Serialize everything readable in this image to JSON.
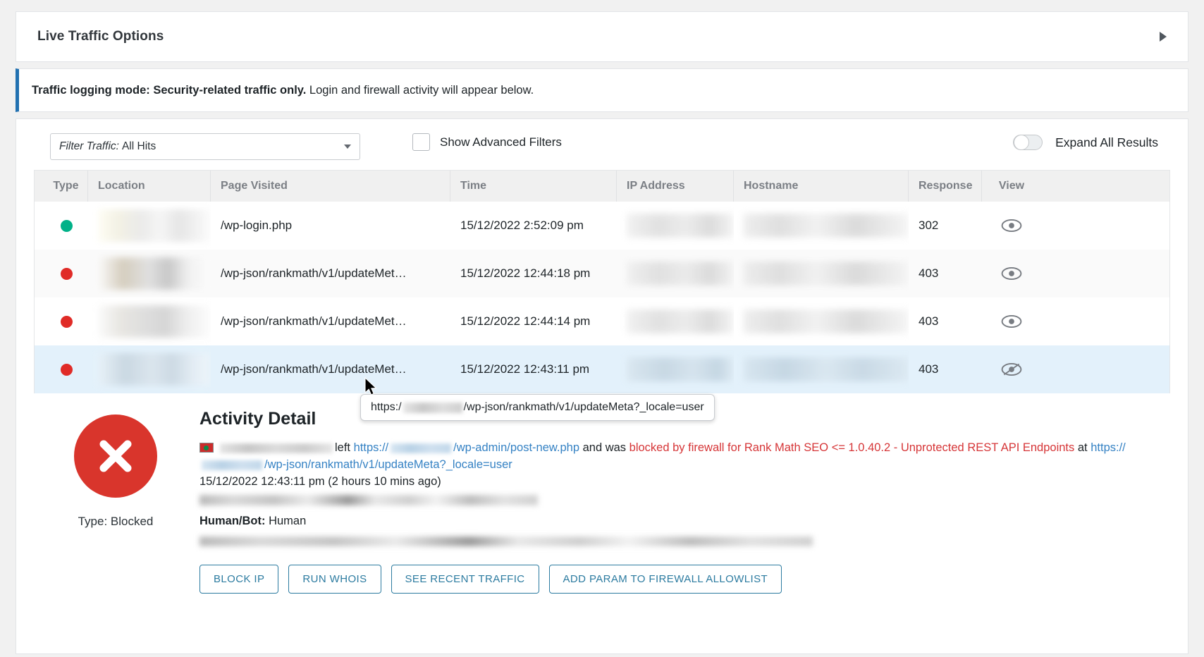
{
  "options_panel": {
    "title": "Live Traffic Options",
    "expand_icon": "chevron-right-icon"
  },
  "notice": {
    "bold_text": "Traffic logging mode: Security-related traffic only.",
    "rest_text": " Login and firewall activity will appear below."
  },
  "filters": {
    "select_label": "Filter Traffic:",
    "select_value": "All Hits",
    "advanced_filters_label": "Show Advanced Filters",
    "advanced_filters_checked": false,
    "expand_all_label": "Expand All Results",
    "expand_all_on": false
  },
  "table": {
    "columns": [
      "Type",
      "Location",
      "Page Visited",
      "Time",
      "IP Address",
      "Hostname",
      "Response",
      "View"
    ],
    "rows": [
      {
        "type_color": "#00b188",
        "type_name": "allowed",
        "location": "",
        "page": "/wp-login.php",
        "time": "15/12/2022 2:52:09 pm",
        "ip": "",
        "hostname": "",
        "response": "302",
        "view_icon": "eye-icon",
        "selected": false
      },
      {
        "type_color": "#e02b27",
        "type_name": "blocked",
        "location": "",
        "page": "/wp-json/rankmath/v1/updateMet…",
        "time": "15/12/2022 12:44:18 pm",
        "ip": "",
        "hostname": "",
        "response": "403",
        "view_icon": "eye-icon",
        "selected": false
      },
      {
        "type_color": "#e02b27",
        "type_name": "blocked",
        "location": "",
        "page": "/wp-json/rankmath/v1/updateMet…",
        "time": "15/12/2022 12:44:14 pm",
        "ip": "",
        "hostname": "",
        "response": "403",
        "view_icon": "eye-icon",
        "selected": false
      },
      {
        "type_color": "#e02b27",
        "type_name": "blocked",
        "location": "",
        "page": "/wp-json/rankmath/v1/updateMet…",
        "time": "15/12/2022 12:43:11 pm",
        "ip": "",
        "hostname": "",
        "response": "403",
        "view_icon": "eye-slash-icon",
        "selected": true
      }
    ]
  },
  "tooltip": {
    "prefix": "https:/",
    "suffix": "/wp-json/rankmath/v1/updateMeta?_locale=user"
  },
  "detail": {
    "heading": "Activity Detail",
    "type_label": "Type: Blocked",
    "status_icon": "error-circle-x-icon",
    "flag_icon": "bangladesh-flag-icon",
    "line1_left_word": "left",
    "line1_url_suffix": "/wp-admin/post-new.php",
    "line1_and_was": "and was",
    "line1_red": "blocked by firewall for Rank Math SEO <= 1.0.40.2 - Unprotected REST API Endpoints",
    "line1_at": "at",
    "line1_url2_suffix": "/wp-json/rankmath/v1/updateMeta?_locale=user",
    "url_scheme": "https://",
    "timestamp": "15/12/2022 12:43:11 pm (2 hours 10 mins ago)",
    "humanbot_label": "Human/Bot:",
    "humanbot_value": "Human"
  },
  "action_buttons": [
    "BLOCK IP",
    "RUN WHOIS",
    "SEE RECENT TRAFFIC",
    "ADD PARAM TO FIREWALL ALLOWLIST"
  ],
  "colors": {
    "accent_blue": "#2271b1",
    "link_blue": "#3582c4",
    "danger_red": "#d63638",
    "allowed_green": "#00b188",
    "blocked_red": "#e02b27",
    "selected_row": "#e3f1fb"
  }
}
